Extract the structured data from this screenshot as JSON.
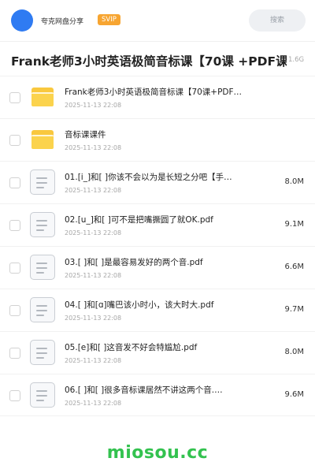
{
  "header": {
    "user_name": "夸克网盘分享",
    "badge": "SVIP",
    "search_placeholder": "搜索"
  },
  "share": {
    "title": "Frank老师3小时英语极简音标课【70课 +PDF课件】",
    "total_size": "1.6G"
  },
  "files": [
    {
      "type": "folder",
      "name": "Frank老师3小时英语极简音标课【70课+PDF…",
      "date": "2025-11-13 22:08",
      "size": ""
    },
    {
      "type": "folder",
      "name": "音标课课件",
      "date": "2025-11-13 22:08",
      "size": ""
    },
    {
      "type": "file",
      "name": "01.[i_]和[ ]你该不会以为是长短之分吧【手…",
      "date": "2025-11-13 22:08",
      "size": "8.0M"
    },
    {
      "type": "file",
      "name": "02.[u_]和[ ]可不是把嘴撅圆了就OK.pdf",
      "date": "2025-11-13 22:08",
      "size": "9.1M"
    },
    {
      "type": "file",
      "name": "03.[ ]和[ ]是最容易发好的两个音.pdf",
      "date": "2025-11-13 22:08",
      "size": "6.6M"
    },
    {
      "type": "file",
      "name": "04.[ ]和[ɑ]嘴巴该小时小，该大时大.pdf",
      "date": "2025-11-13 22:08",
      "size": "9.7M"
    },
    {
      "type": "file",
      "name": "05.[e]和[ ]这音发不好会特尴尬.pdf",
      "date": "2025-11-13 22:08",
      "size": "8.0M"
    },
    {
      "type": "file",
      "name": "06.[ ]和[ ]很多音标课居然不讲这两个音.…",
      "date": "2025-11-13 22:08",
      "size": "9.6M"
    }
  ],
  "watermark": "miosou.cc"
}
